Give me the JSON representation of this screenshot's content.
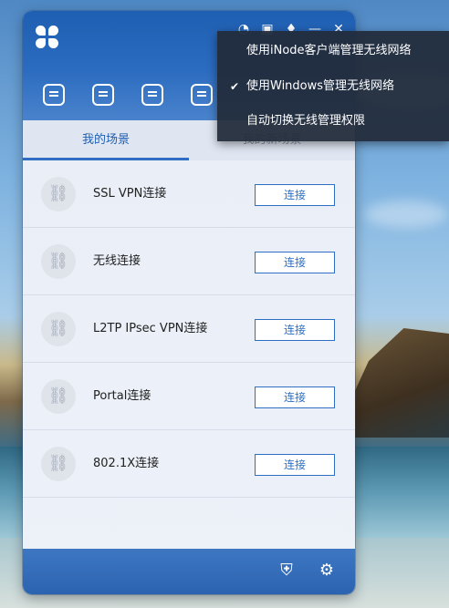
{
  "window": {
    "logo": "inode-logo",
    "controls": [
      "wifi-icon",
      "chat-icon",
      "shirt-icon",
      "minimize-icon",
      "close-icon"
    ],
    "nav_icons": [
      "scene-link-icon",
      "message-icon",
      "news-icon",
      "doc-icon"
    ]
  },
  "tabs": [
    {
      "label": "我的场景"
    },
    {
      "label": "我的新场景"
    }
  ],
  "connections": [
    {
      "label": "SSL VPN连接",
      "button": "连接"
    },
    {
      "label": "无线连接",
      "button": "连接"
    },
    {
      "label": "L2TP IPsec VPN连接",
      "button": "连接"
    },
    {
      "label": "Portal连接",
      "button": "连接"
    },
    {
      "label": "802.1X连接",
      "button": "连接"
    }
  ],
  "context_menu": {
    "items": [
      {
        "label": "使用iNode客户端管理无线网络",
        "checked": false
      },
      {
        "label": "使用Windows管理无线网络",
        "checked": true,
        "check_mark": "✔"
      },
      {
        "label": "自动切换无线管理权限",
        "checked": false
      }
    ]
  },
  "footer": {
    "icons": [
      "shield-e-icon",
      "gear-icon"
    ]
  },
  "colors": {
    "accent": "#2e6fc4",
    "header": "#1f5fb2",
    "menu_bg": "#222c3a"
  }
}
